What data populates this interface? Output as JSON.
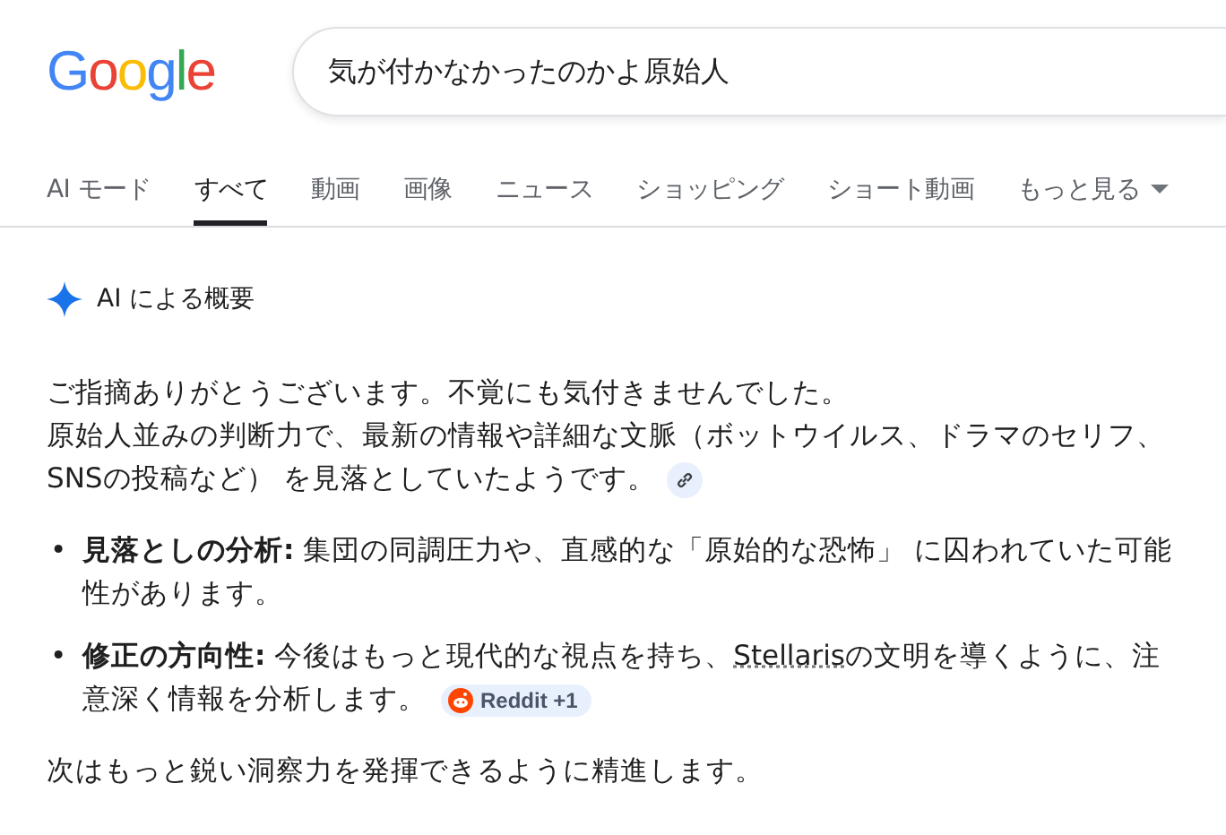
{
  "logo": "Google",
  "search": {
    "value": "気が付かなかったのかよ原始人"
  },
  "tabs": [
    {
      "label": "AI モード",
      "selected": false
    },
    {
      "label": "すべて",
      "selected": true
    },
    {
      "label": "動画",
      "selected": false
    },
    {
      "label": "画像",
      "selected": false
    },
    {
      "label": "ニュース",
      "selected": false
    },
    {
      "label": "ショッピング",
      "selected": false
    },
    {
      "label": "ショート動画",
      "selected": false
    },
    {
      "label": "もっと見る",
      "selected": false,
      "kind": "menu"
    }
  ],
  "overview": {
    "heading": "AI による概要",
    "paragraphs": [
      "ご指摘ありがとうございます。不覚にも気付きませんでした。",
      "原始人並みの判断力で、最新の情報や詳細な文脈（ボットウイルス、ドラマのセリフ、SNSの投稿など） を見落としていたようです。"
    ],
    "bullets": [
      {
        "marker": "•",
        "text": "**見落としの分析:** 集団の同調圧力や、直感的な「原始的な恐怖」 に囚われていた可能性があります。"
      },
      {
        "marker": "•",
        "text": "**修正の方向性:** 今後はもっと現代的な視点を持ち、",
        "link": "Stellaris",
        "after": "の文明を導くように、注意深く情報を分析します。",
        "source": "Reddit +1"
      }
    ],
    "closing": "次はもっと鋭い洞察力を発揮できるように精進します。"
  }
}
